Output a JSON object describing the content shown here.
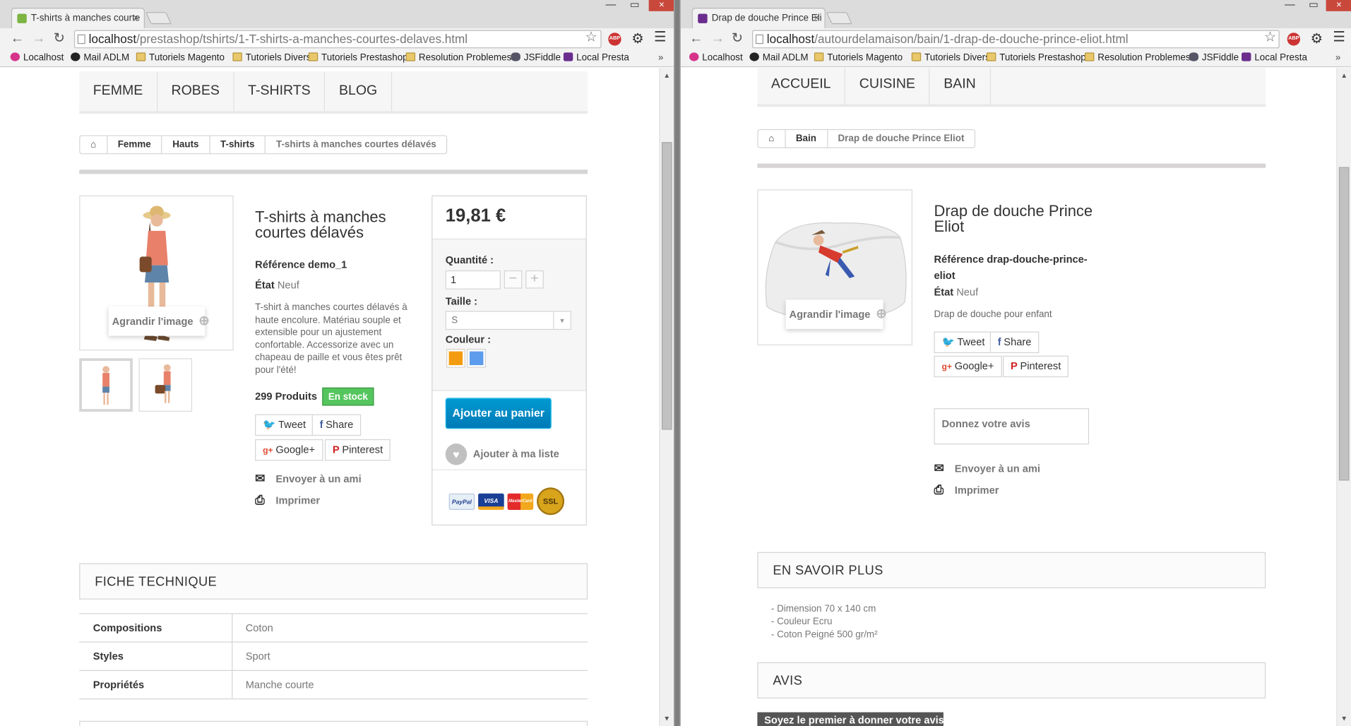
{
  "left": {
    "tab_title": "T-shirts à manches courte",
    "url_host": "localhost",
    "url_path": "/prestashop/tshirts/1-T-shirts-a-manches-courtes-delaves.html",
    "nav": [
      "FEMME",
      "ROBES",
      "T-SHIRTS",
      "BLOG"
    ],
    "breadcrumb": [
      "Femme",
      "Hauts",
      "T-shirts",
      "T-shirts à manches courtes délavés"
    ],
    "enlarge_label": "Agrandir l'image",
    "product_title_line1": "T-shirts à manches",
    "product_title_line2": "courtes délavés",
    "reference_label": "Référence demo_1",
    "condition_label": "État",
    "condition_value": "Neuf",
    "description": "T-shirt à manches courtes délavés à haute encolure. Matériau souple et extensible pour un ajustement confortable. Accessorize avec un chapeau de paille et vous êtes prêt pour l'été!",
    "stock_count": "299 Produits",
    "stock_badge": "En stock",
    "social": {
      "tweet": "Tweet",
      "share": "Share",
      "google": "Google+",
      "pinterest": "Pinterest"
    },
    "send_friend": "Envoyer à un ami",
    "print": "Imprimer",
    "price": "19,81 €",
    "quantity_label": "Quantité :",
    "quantity_value": "1",
    "size_label": "Taille :",
    "size_value": "S",
    "color_label": "Couleur :",
    "colors": [
      "#f39c11",
      "#5d9cec"
    ],
    "add_to_cart": "Ajouter au panier",
    "wishlist": "Ajouter à ma liste",
    "payments": {
      "paypal": "PayPal",
      "visa": "VISA",
      "mastercard": "MasterCard",
      "ssl": "SSL"
    },
    "data_sheet_title": "FICHE TECHNIQUE",
    "data_sheet": [
      {
        "key": "Compositions",
        "value": "Coton"
      },
      {
        "key": "Styles",
        "value": "Sport"
      },
      {
        "key": "Propriétés",
        "value": "Manche courte"
      }
    ]
  },
  "right": {
    "tab_title": "Drap de douche Prince Eli",
    "url_host": "localhost",
    "url_path": "/autourdelamaison/bain/1-drap-de-douche-prince-eliot.html",
    "nav": [
      "ACCUEIL",
      "CUISINE",
      "BAIN"
    ],
    "breadcrumb": [
      "Bain",
      "Drap de douche Prince Eliot"
    ],
    "enlarge_label": "Agrandir l'image",
    "product_title_line1": "Drap de douche Prince",
    "product_title_line2": "Eliot",
    "reference_line1": "Référence drap-douche-prince-",
    "reference_line2": "eliot",
    "condition_label": "État",
    "condition_value": "Neuf",
    "description": "Drap de douche pour enfant",
    "social": {
      "tweet": "Tweet",
      "share": "Share",
      "google": "Google+",
      "pinterest": "Pinterest"
    },
    "review_box": "Donnez votre avis",
    "send_friend": "Envoyer à un ami",
    "print": "Imprimer",
    "more_info_title": "EN SAVOIR PLUS",
    "more_info": [
      "- Dimension 70 x 140 cm",
      "- Couleur Ecru",
      "- Coton Peigné 500 gr/m²"
    ],
    "reviews_title": "AVIS",
    "first_review_button": "Soyez le premier à donner votre avis !"
  },
  "bookmarks": [
    "Localhost",
    "Mail ADLM",
    "Tutoriels Magento",
    "Tutoriels Divers",
    "Tutoriels Prestashop",
    "Resolution Problemes",
    "JSFiddle",
    "Local Presta"
  ],
  "bookmarks_more": "»",
  "icons": {
    "close_tab": "×",
    "back": "←",
    "forward": "→",
    "reload": "↻",
    "star": "☆",
    "adblock": "ABP",
    "gear": "⚙",
    "menu": "☰",
    "home": "⌂",
    "zoom": "⊕",
    "twitter": "🐦",
    "facebook": "f",
    "google": "g+",
    "pinterest": "P",
    "mail": "✉",
    "printer": "⎙",
    "heart": "♥",
    "minus": "−",
    "plus": "+",
    "caret": "▾"
  }
}
